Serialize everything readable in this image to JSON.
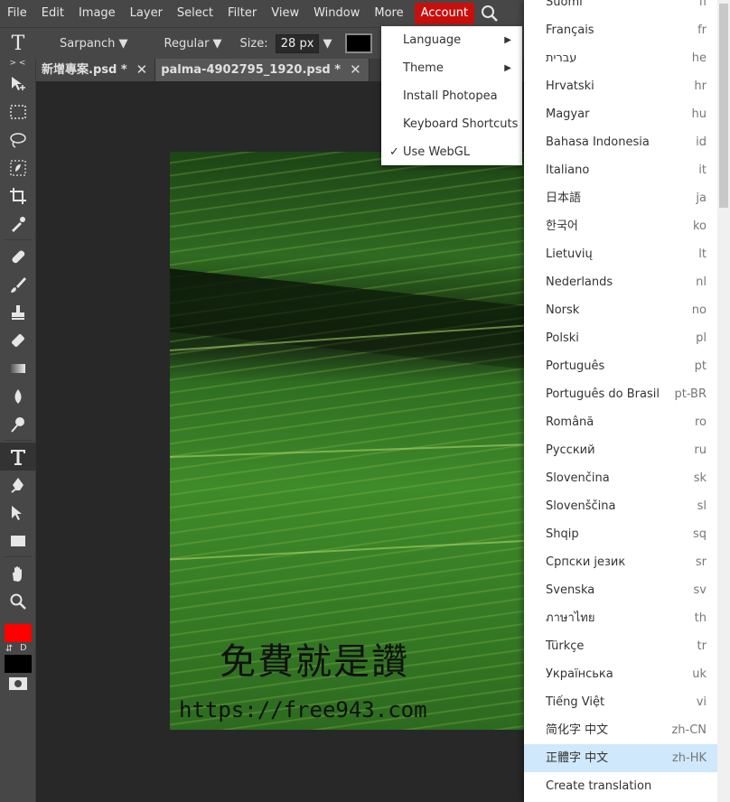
{
  "menubar": {
    "items": [
      "File",
      "Edit",
      "Image",
      "Layer",
      "Select",
      "Filter",
      "View",
      "Window",
      "More",
      "Account"
    ]
  },
  "options_bar": {
    "tool_glyph": "T",
    "font_family": "Sarpanch ▼",
    "font_style": "Regular ▼",
    "size_label": "Size:",
    "size_value": "28 px",
    "size_arrow": "▼",
    "text_color": "#000000"
  },
  "toolbar": {
    "collapse_glyph": "> <",
    "foreground_color": "#ff0000",
    "background_color": "#000000",
    "default_glyph": "D",
    "swap_glyph": "⇵"
  },
  "tabs": [
    {
      "label": "新增專案.psd *",
      "close": "✕"
    },
    {
      "label": "palma-4902795_1920.psd *",
      "close": "✕"
    }
  ],
  "canvas": {
    "watermark_text": "免費就是讚",
    "watermark_url": "https://free943.com"
  },
  "more_menu": {
    "items": [
      {
        "label": "Language",
        "arrow": "▶"
      },
      {
        "label": "Theme",
        "arrow": "▶"
      },
      {
        "label": "Install Photopea"
      },
      {
        "label": "Keyboard Shortcuts"
      },
      {
        "label": "Use WebGL",
        "check": "✓"
      }
    ]
  },
  "language_menu": {
    "items": [
      {
        "name": "Suomi",
        "code": "fi"
      },
      {
        "name": "Français",
        "code": "fr"
      },
      {
        "name": "עברית",
        "code": "he"
      },
      {
        "name": "Hrvatski",
        "code": "hr"
      },
      {
        "name": "Magyar",
        "code": "hu"
      },
      {
        "name": "Bahasa Indonesia",
        "code": "id"
      },
      {
        "name": "Italiano",
        "code": "it"
      },
      {
        "name": "日本語",
        "code": "ja"
      },
      {
        "name": "한국어",
        "code": "ko"
      },
      {
        "name": "Lietuvių",
        "code": "lt"
      },
      {
        "name": "Nederlands",
        "code": "nl"
      },
      {
        "name": "Norsk",
        "code": "no"
      },
      {
        "name": "Polski",
        "code": "pl"
      },
      {
        "name": "Português",
        "code": "pt"
      },
      {
        "name": "Português do Brasil",
        "code": "pt-BR"
      },
      {
        "name": "Română",
        "code": "ro"
      },
      {
        "name": "Русский",
        "code": "ru"
      },
      {
        "name": "Slovenčina",
        "code": "sk"
      },
      {
        "name": "Slovenščina",
        "code": "sl"
      },
      {
        "name": "Shqip",
        "code": "sq"
      },
      {
        "name": "Српски језик",
        "code": "sr"
      },
      {
        "name": "Svenska",
        "code": "sv"
      },
      {
        "name": "ภาษาไทย",
        "code": "th"
      },
      {
        "name": "Türkçe",
        "code": "tr"
      },
      {
        "name": "Українська",
        "code": "uk"
      },
      {
        "name": "Tiếng Việt",
        "code": "vi"
      },
      {
        "name": "简化字 中文",
        "code": "zh-CN"
      },
      {
        "name": "正體字 中文",
        "code": "zh-HK",
        "highlighted": true
      },
      {
        "name": "Create translation",
        "code": ""
      }
    ]
  }
}
